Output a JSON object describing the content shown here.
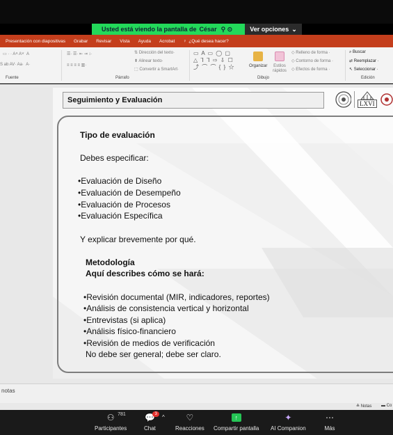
{
  "share_banner": {
    "text": "Usted está viendo la pantalla de",
    "name": "César"
  },
  "view_options": "Ver opciones",
  "ribbon": {
    "tabs": [
      "Presentación con diapositivas",
      "Grabar",
      "Revisar",
      "Vista",
      "Ayuda",
      "Acrobat",
      "¿Qué desea hacer?"
    ],
    "groups": {
      "fuente": "Fuente",
      "parrafo": "Párrafo",
      "dibujo": "Dibujo",
      "edicion": "Edición"
    },
    "paragraph_items": [
      "Dirección del texto",
      "Alinear texto",
      "Convertir a SmartArt"
    ],
    "drawing_items": {
      "organizar": "Organizar",
      "estilos": "Estilos rápidos",
      "relleno": "Relleno de forma",
      "contorno": "Contorno de forma",
      "efectos": "Efectos de forma"
    },
    "edit_items": [
      "Buscar",
      "Reemplazar",
      "Seleccionar"
    ]
  },
  "slide": {
    "title": "Seguimiento y Evaluación",
    "heading": "Tipo de evaluación",
    "intro": "Debes especificar:",
    "types": [
      "•Evaluación de Diseño",
      "•Evaluación de Desempeño",
      "•Evaluación de Procesos",
      "•Evaluación Específica"
    ],
    "explain": "Y explicar brevemente por qué.",
    "method_title": "Metodología",
    "method_sub": "Aquí describes cómo se hará:",
    "method_items": [
      "•Revisión documental (MIR, indicadores, reportes)",
      "•Análisis de consistencia vertical y horizontal",
      "•Entrevistas (si aplica)",
      "•Análisis físico-financiero",
      "•Revisión de medios de verificación"
    ],
    "closing": "No debe ser general; debe ser claro.",
    "logo_text": "LXVI"
  },
  "status": {
    "notes_left": "notas",
    "notes_btn": "Notas",
    "comments_btn": "Co"
  },
  "zoom_bar": {
    "participants": {
      "label": "Participantes",
      "count": "781"
    },
    "chat": {
      "label": "Chat",
      "badge": "3"
    },
    "reactions": "Reacciones",
    "share": "Compartir pantalla",
    "companion": "AI Companion",
    "more": "Más"
  },
  "colors": {
    "ppt_red": "#c43e1c",
    "zoom_green": "#23d95a",
    "zoom_bar": "#1a1a1a"
  }
}
